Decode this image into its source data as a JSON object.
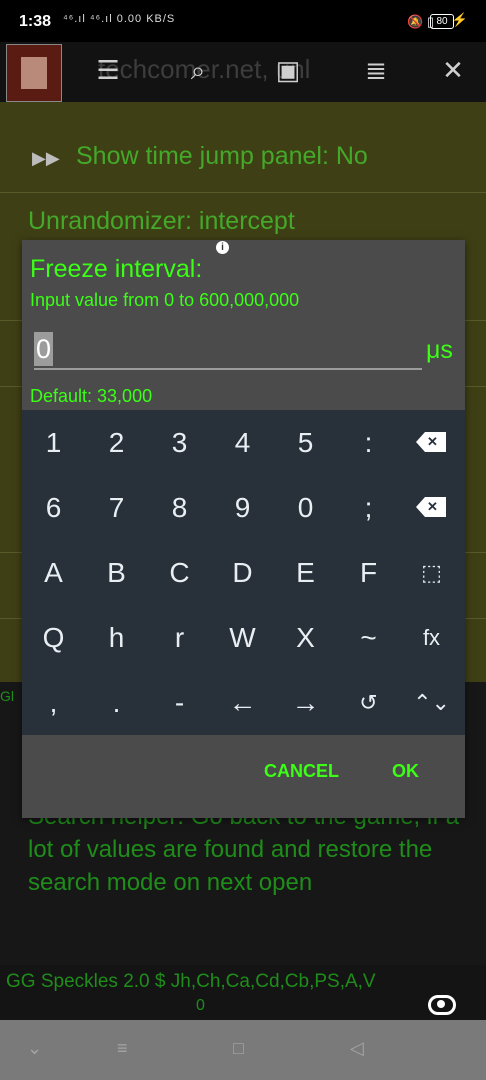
{
  "status_bar": {
    "time": "1:38",
    "net_info": "⁴⁶.ıl ⁴⁶.ıl 0.00 KB/S",
    "battery": "80"
  },
  "app_bar": {
    "url_ghost": "techcomer.net, unl",
    "icons": [
      "tune-icon",
      "search-icon",
      "save-icon",
      "list-icon",
      "close-icon"
    ]
  },
  "background": {
    "show_time_jump": "Show time jump panel: No",
    "unrandomizer": "Unrandomizer: intercept",
    "gl_fragment": "Gl",
    "search_helper": "Search helper: Go back to the game, if a lot of values are found and restore the search mode on next open"
  },
  "footer": {
    "status_line": "GG Speckles 2.0 $ Jh,Ch,Ca,Cd,Cb,PS,A,V",
    "status_line2": "0"
  },
  "dialog": {
    "title": "Freeze interval:",
    "hint": "Input value from 0 to 600,000,000",
    "value": "0",
    "unit": "μs",
    "default": "Default: 33,000",
    "cancel_label": "CANCEL",
    "ok_label": "OK"
  },
  "keyboard": {
    "row1": [
      "1",
      "2",
      "3",
      "4",
      "5",
      ":"
    ],
    "row2": [
      "6",
      "7",
      "8",
      "9",
      "0",
      ";"
    ],
    "row3": [
      "A",
      "B",
      "C",
      "D",
      "E",
      "F"
    ],
    "row4": [
      "Q",
      "h",
      "r",
      "W",
      "X",
      "~",
      "fx"
    ],
    "row5": [
      ",",
      ".",
      "-",
      "←",
      "→"
    ]
  },
  "colors": {
    "accent_green": "#3bff15",
    "dim_green": "#1f8d1a",
    "keyboard_bg": "#283039",
    "dialog_bg": "#4b4b4b"
  }
}
